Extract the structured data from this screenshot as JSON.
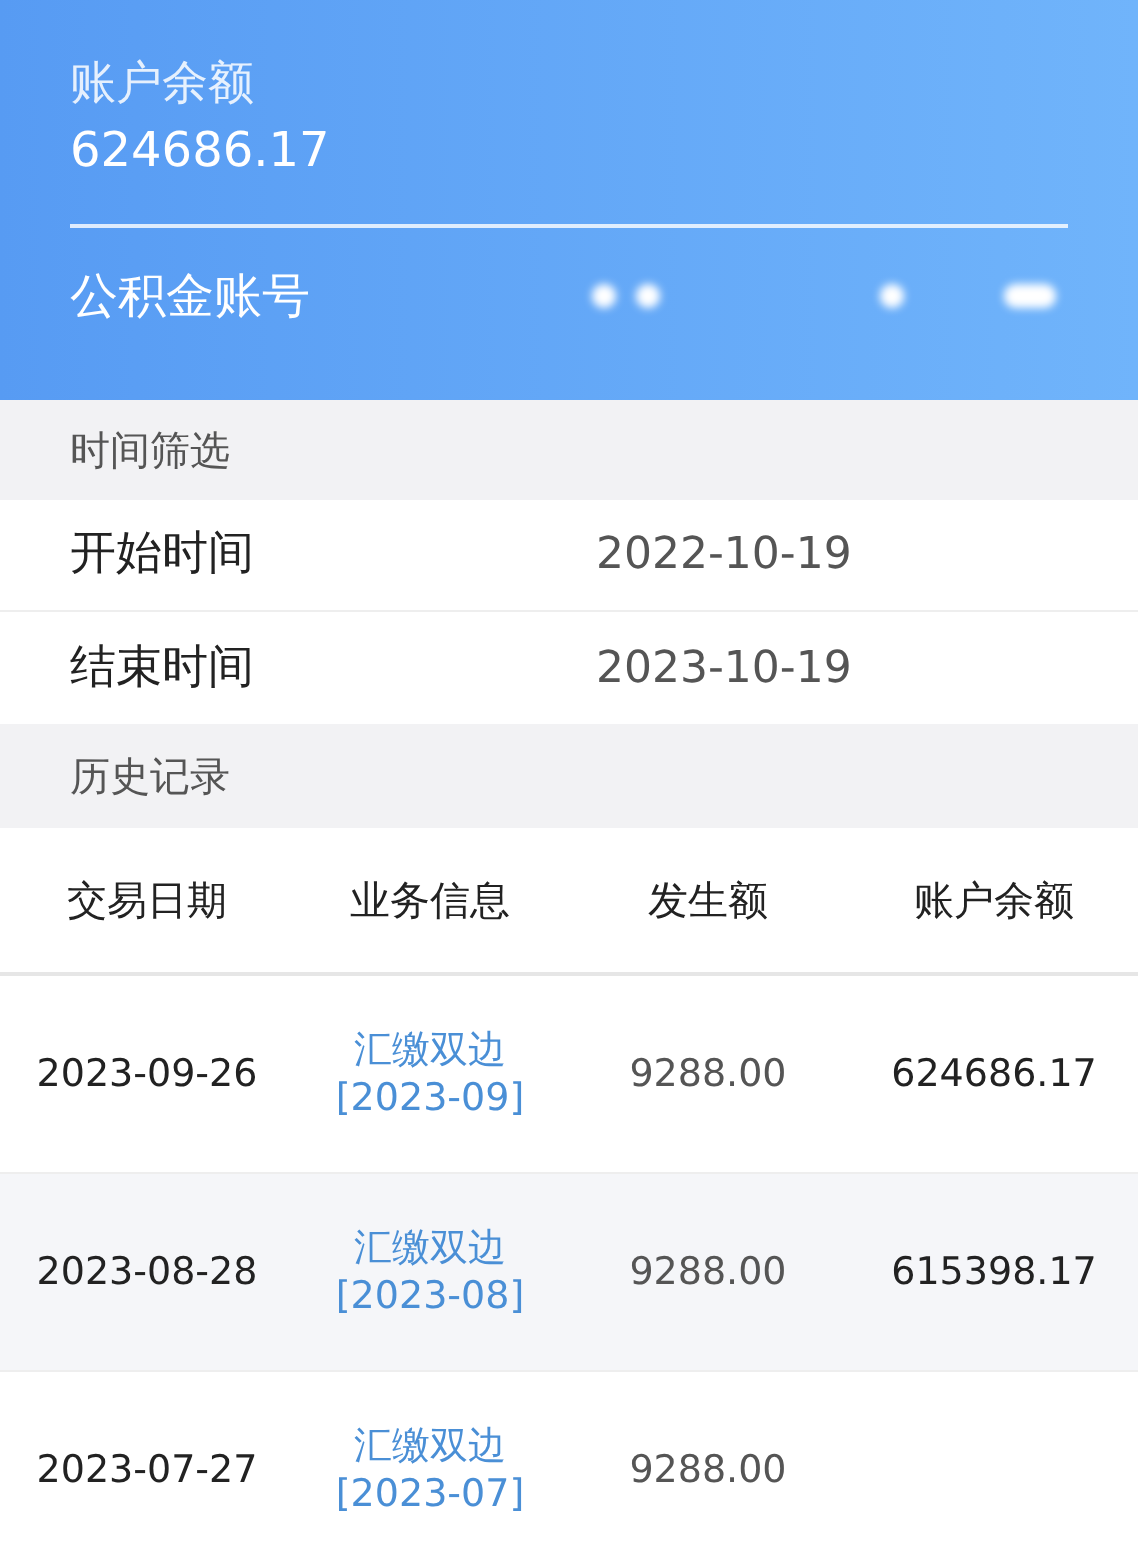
{
  "balance_card": {
    "label": "账户余额",
    "amount": "624686.17",
    "account_label": "公积金账号"
  },
  "filter": {
    "title": "时间筛选",
    "fields": [
      {
        "label": "开始时间",
        "value": "2022-10-19"
      },
      {
        "label": "结束时间",
        "value": "2023-10-19"
      }
    ]
  },
  "history": {
    "title": "历史记录",
    "columns": [
      "交易日期",
      "业务信息",
      "发生额",
      "账户余额"
    ],
    "rows": [
      {
        "date": "2023-09-26",
        "info": [
          "汇缴双边",
          "[2023-09]"
        ],
        "amount": "9288.00",
        "balance": "624686.17"
      },
      {
        "date": "2023-08-28",
        "info": [
          "汇缴双边",
          "[2023-08]"
        ],
        "amount": "9288.00",
        "balance": "615398.17"
      },
      {
        "date": "2023-07-27",
        "info": [
          "汇缴双边",
          "[2023-07]"
        ],
        "amount": "9288.00"
      }
    ]
  }
}
